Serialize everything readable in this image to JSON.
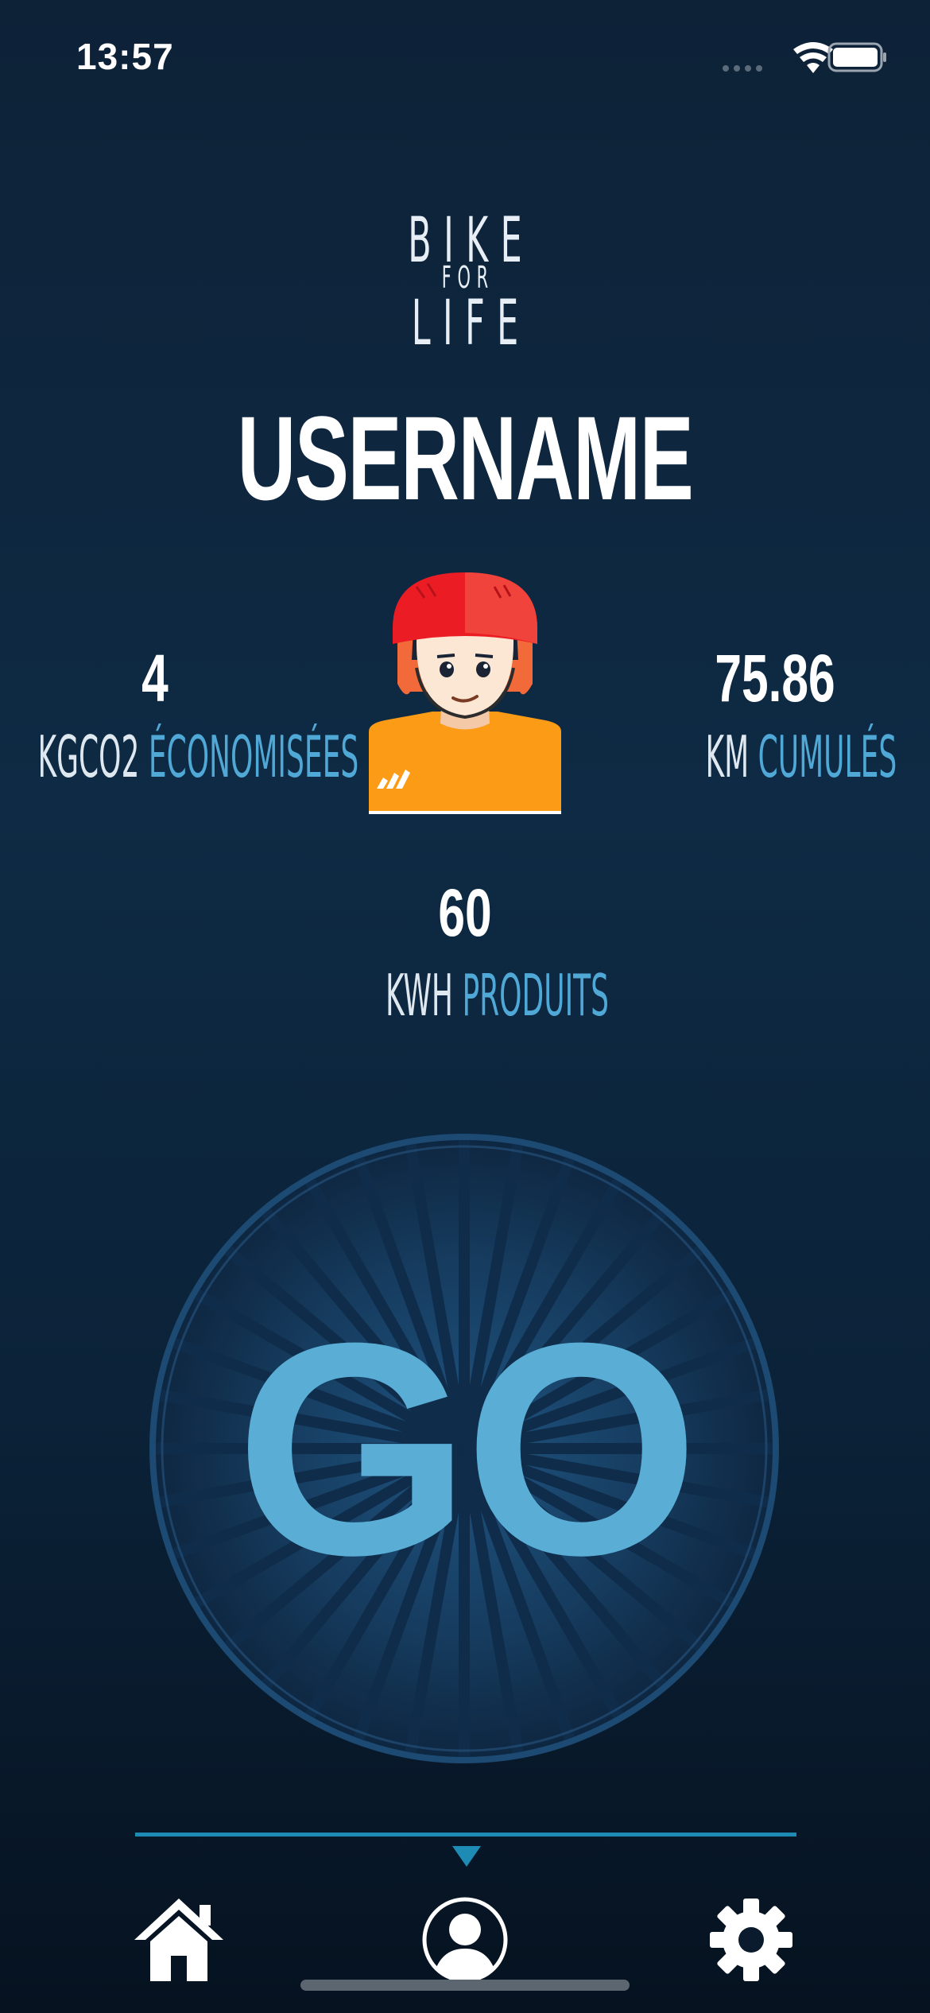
{
  "status_bar": {
    "time": "13:57",
    "icons": [
      "signal-icon",
      "wifi-icon",
      "battery-icon"
    ]
  },
  "logo": {
    "line1": "BIKE",
    "line2": "FOR",
    "line3": "LIFE"
  },
  "profile": {
    "username": "USERNAME"
  },
  "stats": {
    "co2": {
      "value": "4",
      "unit": "KGCO2",
      "label": "ÉCONOMISÉES"
    },
    "km": {
      "value": "75.86",
      "unit": "KM",
      "label": "CUMULÉS"
    },
    "kwh": {
      "value": "60",
      "unit": "KWH",
      "label": "PRODUITS"
    }
  },
  "go_button": {
    "label": "GO"
  },
  "tab_bar": {
    "tabs": [
      {
        "name": "home",
        "icon": "home-icon",
        "selected": false
      },
      {
        "name": "profile",
        "icon": "user-circle-icon",
        "selected": true
      },
      {
        "name": "settings",
        "icon": "gear-icon",
        "selected": false
      }
    ]
  },
  "colors": {
    "accent": "#4fa8d6",
    "go_text": "#5aaed6",
    "indicator": "#1e8bb5",
    "background_top": "#0d2237",
    "background_bottom": "#061220"
  }
}
